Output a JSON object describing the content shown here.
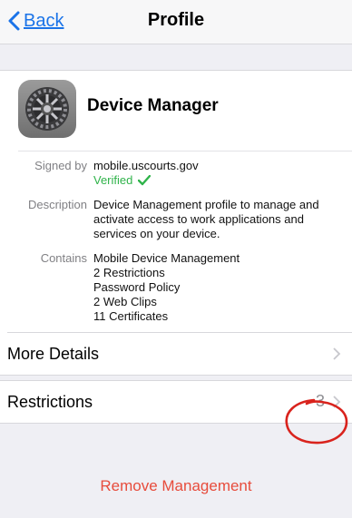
{
  "navbar": {
    "back_label": "Back",
    "title": "Profile"
  },
  "profile": {
    "name": "Device Manager",
    "icon": "gear-settings-icon"
  },
  "details": {
    "signed_by_label": "Signed by",
    "signed_by_value": "mobile.uscourts.gov",
    "verified_label": "Verified",
    "description_label": "Description",
    "description_value": "Device Management profile to manage and activate access to work applications and services on your device.",
    "contains_label": "Contains",
    "contains_items": [
      "Mobile Device Management",
      "2 Restrictions",
      "Password Policy",
      "2 Web Clips",
      "11 Certificates"
    ]
  },
  "rows": {
    "more_details_label": "More Details",
    "restrictions_label": "Restrictions",
    "restrictions_count": "3"
  },
  "actions": {
    "remove_label": "Remove Management"
  },
  "colors": {
    "ios_blue": "#1a73e8",
    "verified_green": "#2fb34a",
    "destructive_red": "#e74c3c",
    "annotation_red": "#d9231d"
  }
}
